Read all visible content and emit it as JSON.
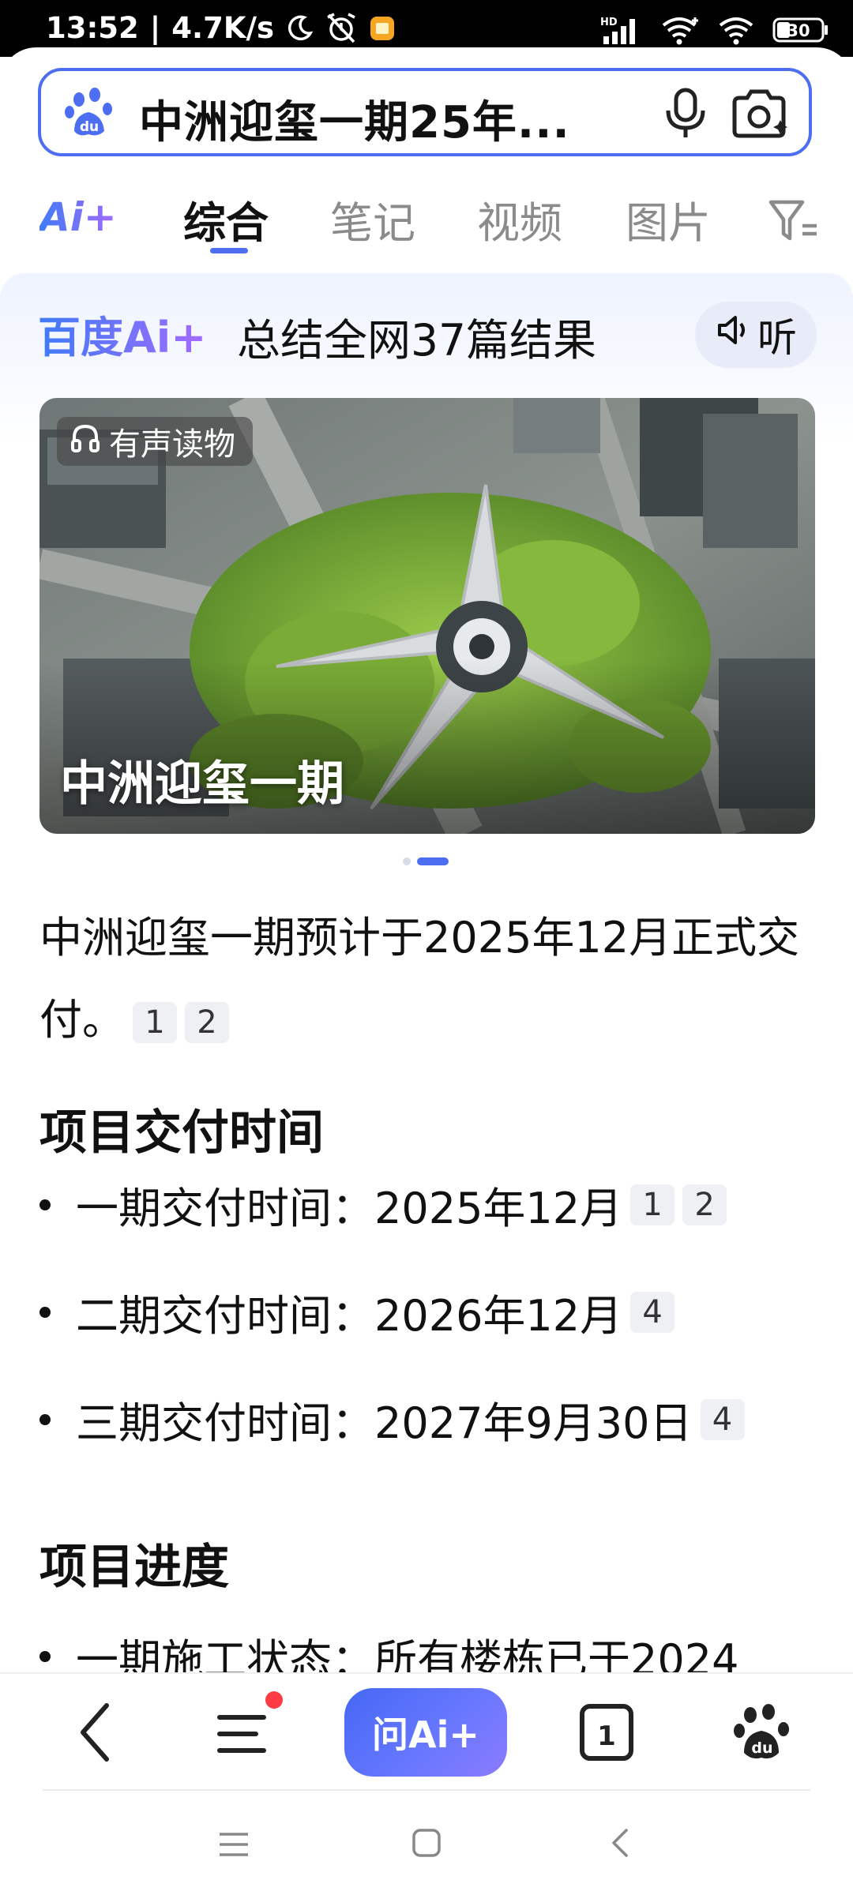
{
  "status_bar": {
    "time": "13:52",
    "network_speed": "4.7K/s",
    "signal_label": "HD",
    "battery": "30",
    "icons": [
      "moon-icon",
      "alarm-off-icon",
      "app-notification-icon",
      "signal-icon",
      "wifi-icon",
      "wifi-icon",
      "battery-icon"
    ]
  },
  "search": {
    "query": "中洲迎玺一期25年...",
    "icons": [
      "baidu-paw-icon",
      "microphone-icon",
      "camera-search-icon"
    ]
  },
  "tabs": {
    "ai_label": "Ai+",
    "items": [
      "综合",
      "笔记",
      "视频",
      "图片"
    ],
    "active_index": 0,
    "filter_icon": "filter-icon"
  },
  "ai_card": {
    "brand": "百度Ai+",
    "summary": "总结全网37篇结果",
    "listen_label": "听",
    "hero": {
      "badge": "有声读物",
      "caption": "中洲迎玺一期"
    },
    "carousel": {
      "total": 2,
      "active": 1
    },
    "answer": {
      "text": "中洲迎玺一期预计于2025年12月正式交付。",
      "citations": [
        "1",
        "2"
      ]
    },
    "sections": [
      {
        "title": "项目交付时间",
        "items": [
          {
            "text": "一期交付时间：2025年12月",
            "citations": [
              "1",
              "2"
            ]
          },
          {
            "text": "二期交付时间：2026年12月",
            "citations": [
              "4"
            ]
          },
          {
            "text": "三期交付时间：2027年9月30日",
            "citations": [
              "4"
            ]
          }
        ]
      },
      {
        "title": "项目进度",
        "items": [
          {
            "text": "一期施工状态：所有楼栋已于2024",
            "citations": []
          }
        ]
      }
    ]
  },
  "bottom_toolbar": {
    "ask_ai_label": "问Ai+",
    "tab_count": "1",
    "icons": [
      "back-icon",
      "menu-icon",
      "tabs-icon",
      "baidu-home-icon"
    ]
  },
  "colors": {
    "accent": "#4e6ef2",
    "ai_purple": "#8c7bff",
    "badge_red": "#ff3b46"
  }
}
